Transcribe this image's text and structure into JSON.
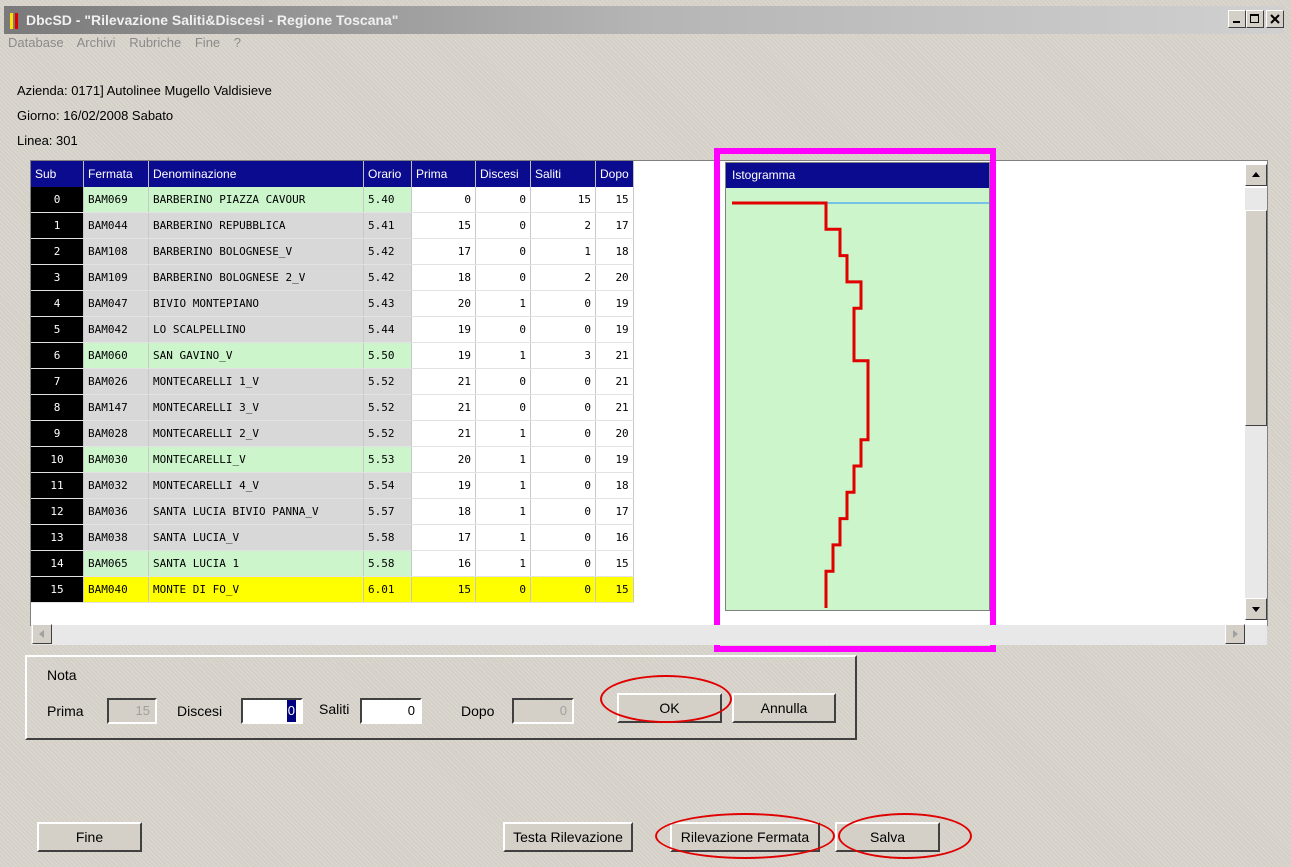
{
  "window": {
    "title": "DbcSD - \"Rilevazione Saliti&Discesi - Regione Toscana\""
  },
  "menu": [
    "Database",
    "Archivi",
    "Rubriche",
    "Fine",
    "?"
  ],
  "info": {
    "azienda": "Azienda: 0171] Autolinee Mugello Valdisieve",
    "giorno": "Giorno: 16/02/2008 Sabato",
    "linea": "Linea: 301"
  },
  "table": {
    "columns": [
      "Sub",
      "Fermata",
      "Denominazione",
      "Orario",
      "Prima",
      "Discesi",
      "Saliti",
      "Dopo"
    ],
    "rows": [
      {
        "sub": "0",
        "fermata": "BAM069",
        "den": "BARBERINO PIAZZA CAVOUR",
        "orario": "5.40",
        "prima": "0",
        "discesi": "0",
        "saliti": "15",
        "dopo": "15",
        "style": "green"
      },
      {
        "sub": "1",
        "fermata": "BAM044",
        "den": "BARBERINO REPUBBLICA",
        "orario": "5.41",
        "prima": "15",
        "discesi": "0",
        "saliti": "2",
        "dopo": "17",
        "style": "grey"
      },
      {
        "sub": "2",
        "fermata": "BAM108",
        "den": "BARBERINO BOLOGNESE_V",
        "orario": "5.42",
        "prima": "17",
        "discesi": "0",
        "saliti": "1",
        "dopo": "18",
        "style": "grey"
      },
      {
        "sub": "3",
        "fermata": "BAM109",
        "den": "BARBERINO BOLOGNESE 2_V",
        "orario": "5.42",
        "prima": "18",
        "discesi": "0",
        "saliti": "2",
        "dopo": "20",
        "style": "grey"
      },
      {
        "sub": "4",
        "fermata": "BAM047",
        "den": "BIVIO MONTEPIANO",
        "orario": "5.43",
        "prima": "20",
        "discesi": "1",
        "saliti": "0",
        "dopo": "19",
        "style": "grey"
      },
      {
        "sub": "5",
        "fermata": "BAM042",
        "den": "LO SCALPELLINO",
        "orario": "5.44",
        "prima": "19",
        "discesi": "0",
        "saliti": "0",
        "dopo": "19",
        "style": "grey"
      },
      {
        "sub": "6",
        "fermata": "BAM060",
        "den": "SAN GAVINO_V",
        "orario": "5.50",
        "prima": "19",
        "discesi": "1",
        "saliti": "3",
        "dopo": "21",
        "style": "green"
      },
      {
        "sub": "7",
        "fermata": "BAM026",
        "den": "MONTECARELLI 1_V",
        "orario": "5.52",
        "prima": "21",
        "discesi": "0",
        "saliti": "0",
        "dopo": "21",
        "style": "grey"
      },
      {
        "sub": "8",
        "fermata": "BAM147",
        "den": "MONTECARELLI 3_V",
        "orario": "5.52",
        "prima": "21",
        "discesi": "0",
        "saliti": "0",
        "dopo": "21",
        "style": "grey"
      },
      {
        "sub": "9",
        "fermata": "BAM028",
        "den": "MONTECARELLI 2_V",
        "orario": "5.52",
        "prima": "21",
        "discesi": "1",
        "saliti": "0",
        "dopo": "20",
        "style": "grey"
      },
      {
        "sub": "10",
        "fermata": "BAM030",
        "den": "MONTECARELLI_V",
        "orario": "5.53",
        "prima": "20",
        "discesi": "1",
        "saliti": "0",
        "dopo": "19",
        "style": "green"
      },
      {
        "sub": "11",
        "fermata": "BAM032",
        "den": "MONTECARELLI 4_V",
        "orario": "5.54",
        "prima": "19",
        "discesi": "1",
        "saliti": "0",
        "dopo": "18",
        "style": "grey"
      },
      {
        "sub": "12",
        "fermata": "BAM036",
        "den": "SANTA LUCIA BIVIO PANNA_V",
        "orario": "5.57",
        "prima": "18",
        "discesi": "1",
        "saliti": "0",
        "dopo": "17",
        "style": "grey"
      },
      {
        "sub": "13",
        "fermata": "BAM038",
        "den": "SANTA LUCIA_V",
        "orario": "5.58",
        "prima": "17",
        "discesi": "1",
        "saliti": "0",
        "dopo": "16",
        "style": "grey"
      },
      {
        "sub": "14",
        "fermata": "BAM065",
        "den": "SANTA LUCIA 1",
        "orario": "5.58",
        "prima": "16",
        "discesi": "1",
        "saliti": "0",
        "dopo": "15",
        "style": "green"
      },
      {
        "sub": "15",
        "fermata": "BAM040",
        "den": "MONTE DI FO_V",
        "orario": "6.01",
        "prima": "15",
        "discesi": "0",
        "saliti": "0",
        "dopo": "15",
        "style": "yellow"
      }
    ]
  },
  "histogram": {
    "header": "Istogramma",
    "max_value": 21
  },
  "nota": {
    "title": "Nota",
    "prima_label": "Prima",
    "prima_value": "15",
    "discesi_label": "Discesi",
    "discesi_value": "0",
    "saliti_label": "Saliti",
    "saliti_value": "0",
    "dopo_label": "Dopo",
    "dopo_value": "0",
    "ok_label": "OK",
    "annulla_label": "Annulla"
  },
  "footer": {
    "fine_label": "Fine",
    "testa_label": "Testa Rilevazione",
    "rilevazione_label": "Rilevazione Fermata",
    "salva_label": "Salva"
  },
  "colors": {
    "highlight_box": "#ff00ff",
    "annotation_ring": "#e00000",
    "histogram_line": "#e00000"
  }
}
